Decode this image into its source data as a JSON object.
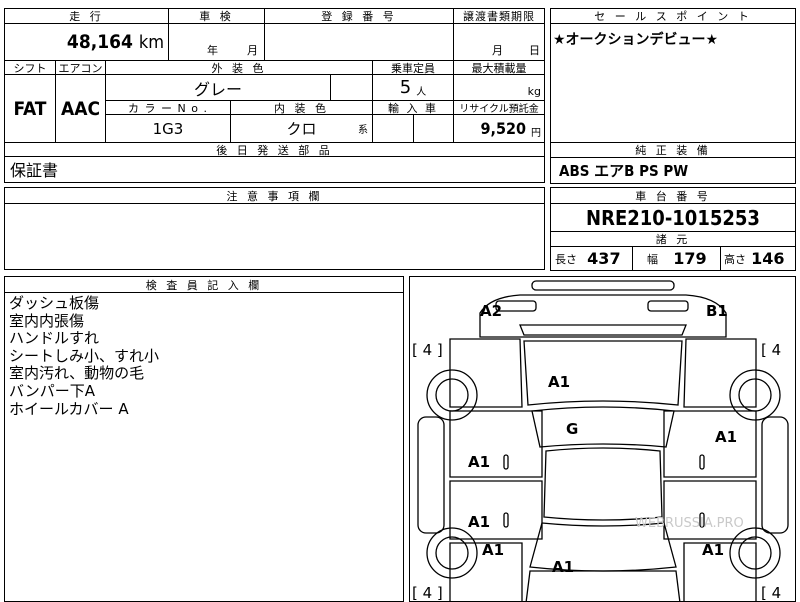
{
  "info": {
    "mileage_label": "走 行",
    "mileage_value": "48,164",
    "mileage_unit": "km",
    "inspection_label": "車 検",
    "inspection_year": "年",
    "inspection_month": "月",
    "registration_label": "登 録 番 号",
    "transfer_label": "譲渡書類期限",
    "transfer_month": "月",
    "transfer_day": "日",
    "shift_label": "シフト",
    "shift_value": "FAT",
    "ac_label": "エアコン",
    "ac_value": "AAC",
    "exterior_label": "外 装 色",
    "exterior_value": "グレー",
    "capacity_label": "乗車定員",
    "capacity_value": "5",
    "capacity_unit": "人",
    "load_label": "最大積載量",
    "load_unit": "kg",
    "colorno_label": "カ ラ ー N o .",
    "colorno_value": "1G3",
    "interior_label": "内 装 色",
    "interior_value": "クロ",
    "interior_suffix": "系",
    "import_label": "輸 入 車",
    "recycle_label": "リサイクル預託金",
    "recycle_value": "9,520",
    "recycle_unit": "円",
    "later_parts_label": "後 日 発 送 部 品",
    "later_parts_value": "保証書"
  },
  "sales": {
    "label": "セ ー ル ス ポ イ ン ト",
    "text": "★オークションデビュー★"
  },
  "equipment": {
    "label": "純 正 装 備",
    "value": "ABS エアB PS PW"
  },
  "notes": {
    "label": "注 意 事 項 欄"
  },
  "chassis": {
    "label": "車 台 番 号",
    "value": "NRE210-1015253",
    "spec_label": "諸 元",
    "length_label": "長さ",
    "length_value": "437",
    "width_label": "幅",
    "width_value": "179",
    "height_label": "高さ",
    "height_value": "146"
  },
  "inspector": {
    "label": "検 査 員 記 入 欄",
    "lines": [
      "ダッシュ板傷",
      "室内内張傷",
      "ハンドルすれ",
      "シートしみ小、すれ小",
      "室内汚れ、動物の毛",
      "バンパー下A",
      "ホイールカバー A"
    ]
  },
  "diagram": {
    "marks": {
      "front_left": "A2",
      "front_right": "B1",
      "bonnet": "A1",
      "windshield": "G",
      "right_front_fender": "A1",
      "left_front_door": "A1",
      "left_rear_door": "A1",
      "left_rear_fender": "A1",
      "right_rear_fender": "A1",
      "trunk": "A1"
    },
    "tire_top_left": "[ 4 ]",
    "tire_top_right": "[ 4",
    "tire_bottom_left": "[ 4 ]",
    "tire_bottom_right": "[ 4",
    "watermark": "WEBRUSSIA.PRO"
  }
}
